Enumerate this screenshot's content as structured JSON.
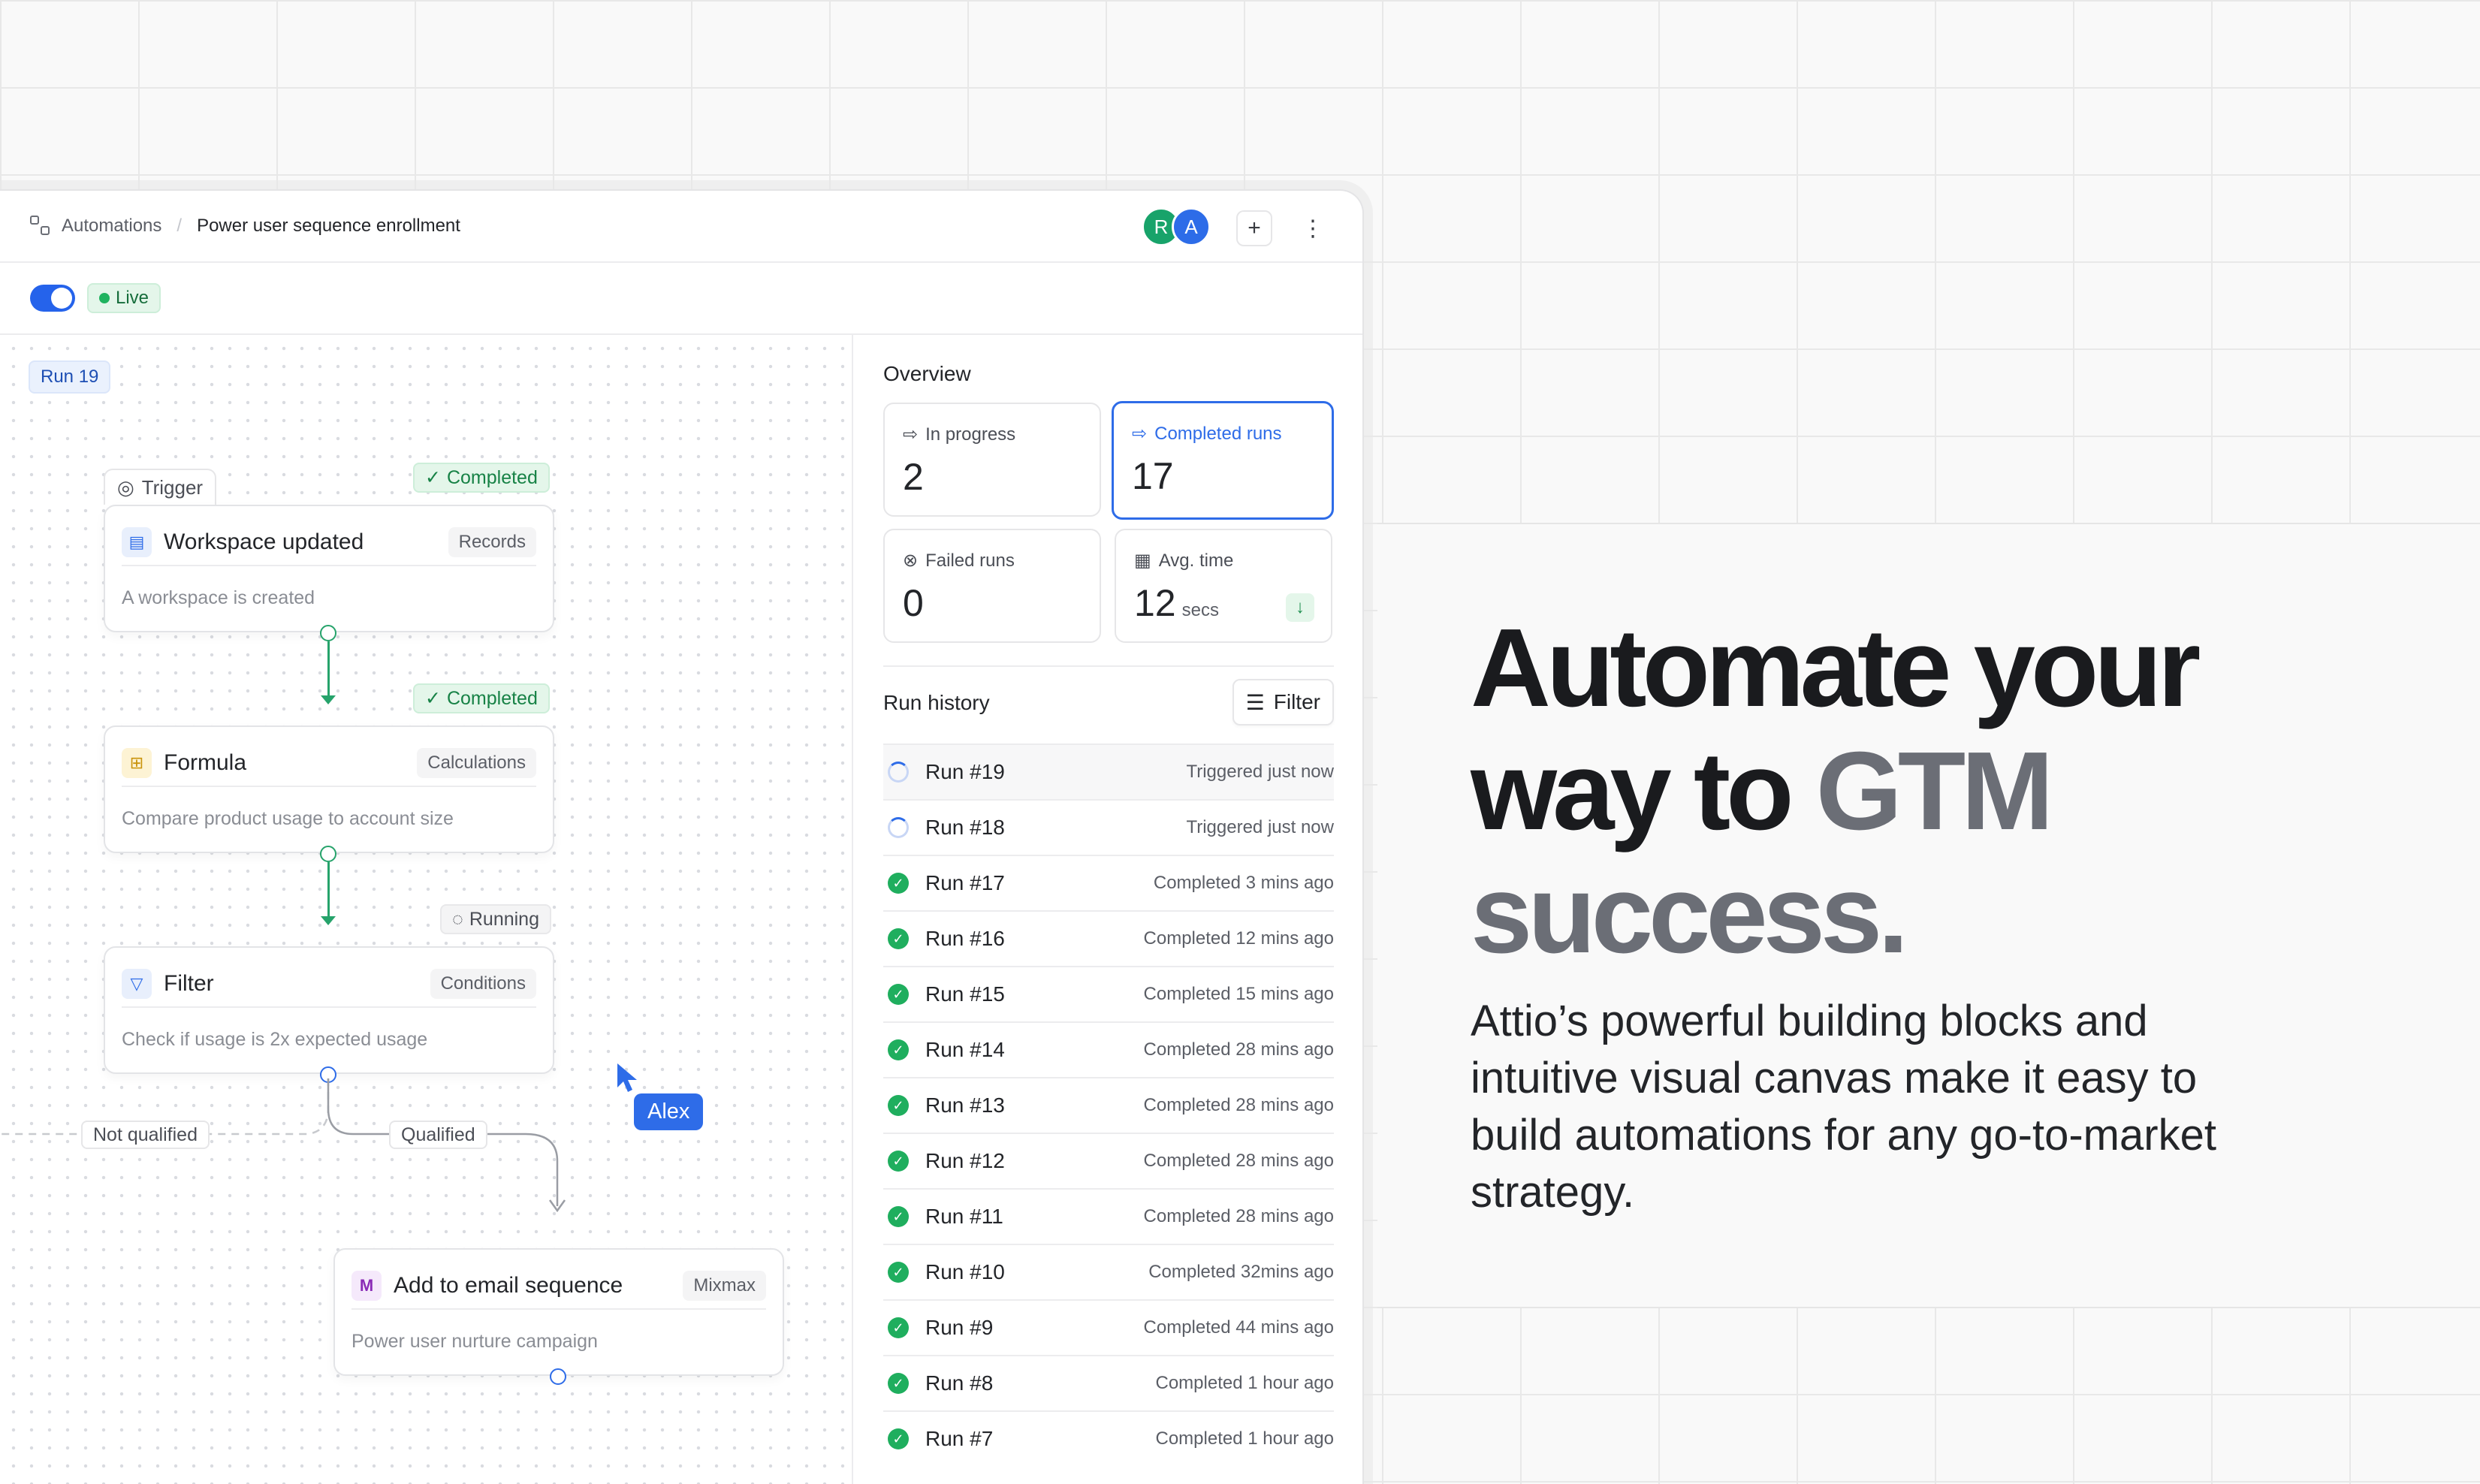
{
  "breadcrumb": {
    "parent": "Automations",
    "current": "Power user sequence enrollment"
  },
  "avatars": [
    "R",
    "A"
  ],
  "toolbar": {
    "add_label": "+",
    "more_label": "⋮"
  },
  "status": {
    "live_label": "Live"
  },
  "canvas": {
    "run_label": "Run 19",
    "trigger_tag": "Trigger",
    "nodes": [
      {
        "title": "Workspace updated",
        "chip": "Records",
        "desc": "A workspace is created",
        "status": "Completed"
      },
      {
        "title": "Formula",
        "chip": "Calculations",
        "desc": "Compare product usage to account size",
        "status": "Completed"
      },
      {
        "title": "Filter",
        "chip": "Conditions",
        "desc": "Check if usage is 2x expected usage",
        "status": "Running"
      },
      {
        "title": "Add to email sequence",
        "chip": "Mixmax",
        "desc": "Power user nurture campaign"
      }
    ],
    "branch_not_qualified": "Not qualified",
    "branch_qualified": "Qualified",
    "cursor_user": "Alex",
    "colors": {
      "edge": "#26a36b",
      "port_green": "#26a36b",
      "port_blue": "#2e6ce8"
    }
  },
  "overview": {
    "title": "Overview",
    "stats": [
      {
        "label": "In progress",
        "value": "2",
        "unit": ""
      },
      {
        "label": "Completed runs",
        "value": "17",
        "unit": ""
      },
      {
        "label": "Failed runs",
        "value": "0",
        "unit": ""
      },
      {
        "label": "Avg. time",
        "value": "12",
        "unit": "secs"
      }
    ]
  },
  "run_history": {
    "title": "Run history",
    "filter_label": "Filter",
    "runs": [
      {
        "name": "Run #19",
        "time": "Triggered just now",
        "state": "running"
      },
      {
        "name": "Run #18",
        "time": "Triggered just now",
        "state": "running"
      },
      {
        "name": "Run #17",
        "time": "Completed 3 mins ago",
        "state": "completed"
      },
      {
        "name": "Run #16",
        "time": "Completed 12 mins ago",
        "state": "completed"
      },
      {
        "name": "Run #15",
        "time": "Completed 15 mins ago",
        "state": "completed"
      },
      {
        "name": "Run #14",
        "time": "Completed 28 mins ago",
        "state": "completed"
      },
      {
        "name": "Run #13",
        "time": "Completed 28 mins ago",
        "state": "completed"
      },
      {
        "name": "Run #12",
        "time": "Completed 28 mins ago",
        "state": "completed"
      },
      {
        "name": "Run #11",
        "time": "Completed 28 mins ago",
        "state": "completed"
      },
      {
        "name": "Run #10",
        "time": "Completed 32mins ago",
        "state": "completed"
      },
      {
        "name": "Run #9",
        "time": "Completed 44 mins ago",
        "state": "completed"
      },
      {
        "name": "Run #8",
        "time": "Completed 1 hour ago",
        "state": "completed"
      },
      {
        "name": "Run #7",
        "time": "Completed 1 hour ago",
        "state": "completed"
      }
    ]
  },
  "hero": {
    "headline_part1": "Automate your way to",
    "headline_highlight": "GTM success.",
    "subtext": "Attio’s powerful building blocks and intuitive visual canvas make it easy to build automations for any go-to-market strategy."
  },
  "colors": {
    "accent": "#2e6ce8",
    "success": "#1fae5e",
    "live_bg": "#e4f6ea"
  }
}
